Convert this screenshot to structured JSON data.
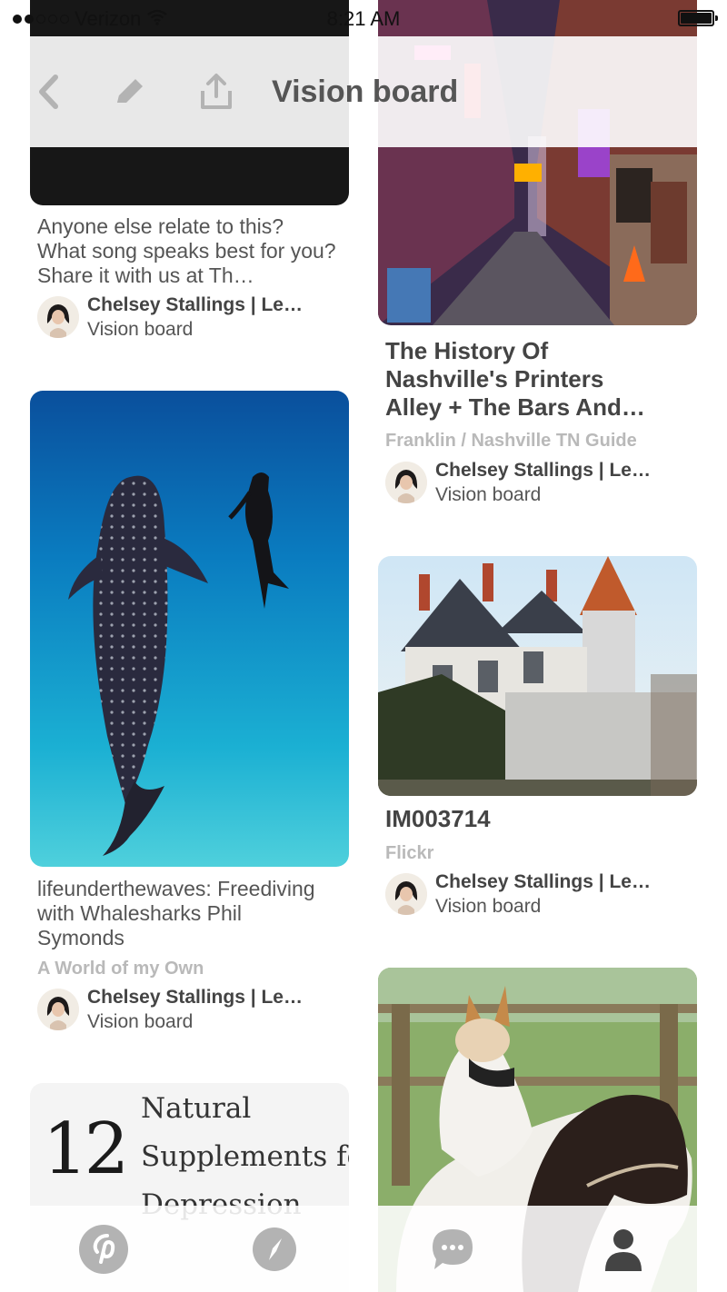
{
  "status_bar": {
    "carrier": "Verizon",
    "time": "8:21 AM",
    "signal_bars_filled": 2,
    "signal_bars_total": 5,
    "battery": "full"
  },
  "header": {
    "title": "Vision board",
    "icons": [
      "back-chevron-icon",
      "edit-pencil-icon",
      "share-icon"
    ]
  },
  "pins": [
    {
      "title": "Anyone else relate to this? What song speaks best for you? Share it with us at Th…",
      "attribution": {
        "name": "Chelsey Stallings | Le…",
        "board": "Vision board"
      }
    },
    {
      "title": "The History Of Nashville's Printers Alley + The Bars And…",
      "source": "Franklin / Nashville TN Guide",
      "attribution": {
        "name": "Chelsey Stallings | Le…",
        "board": "Vision board"
      }
    },
    {
      "title": "lifeunderthewaves: Freediving with Whalesharks Phil Symonds",
      "source": "A World of my Own",
      "attribution": {
        "name": "Chelsey Stallings | Le…",
        "board": "Vision board"
      }
    },
    {
      "title": "IM003714",
      "source": "Flickr",
      "attribution": {
        "name": "Chelsey Stallings | Le…",
        "board": "Vision board"
      }
    },
    {
      "image_text": {
        "number": "12",
        "line1": "Natural",
        "line2": "Supplements for",
        "line3": "Depression"
      }
    }
  ],
  "tab_bar": {
    "tabs": [
      "pinterest-home-icon",
      "explore-compass-icon",
      "messages-icon",
      "profile-icon"
    ],
    "active": "profile-icon"
  },
  "colors": {
    "header_text": "#555555",
    "source_text": "#b9b9b9",
    "icon_gray": "#b3b3b3",
    "active_tab": "#444444"
  }
}
